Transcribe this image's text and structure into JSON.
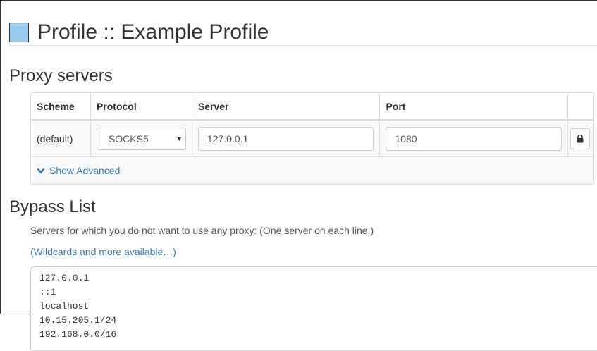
{
  "header": {
    "title": "Profile :: Example Profile",
    "profile_color": "#99ccee"
  },
  "proxy": {
    "heading": "Proxy servers",
    "columns": {
      "scheme": "Scheme",
      "protocol": "Protocol",
      "server": "Server",
      "port": "Port"
    },
    "rows": [
      {
        "scheme": "(default)",
        "protocol": "SOCKS5",
        "server": "127.0.0.1",
        "port": "1080"
      }
    ],
    "show_advanced": "Show Advanced"
  },
  "bypass": {
    "heading": "Bypass List",
    "help_text": "Servers for which you do not want to use any proxy: (One server on each line.)",
    "wildcards_link": "(Wildcards and more available…)",
    "lines": [
      "127.0.0.1",
      "::1",
      "localhost",
      "10.15.205.1/24",
      "192.168.0.0/16"
    ]
  }
}
